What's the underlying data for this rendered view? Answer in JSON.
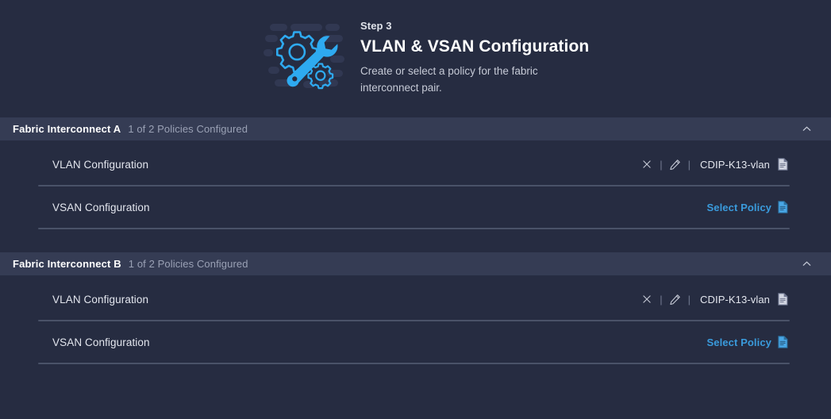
{
  "step": {
    "eyebrow": "Step 3",
    "title": "VLAN & VSAN Configuration",
    "description": "Create or select a policy for the fabric interconnect pair.",
    "icon": "gear-wrench-icon"
  },
  "colors": {
    "page_background": "#262c41",
    "section_header_background": "#353c54",
    "accent_blue": "#3a9bdc",
    "divider": "#4a5268",
    "text_primary": "#e6e8ef",
    "text_muted": "#9aa1b5"
  },
  "sections": [
    {
      "title": "Fabric Interconnect A",
      "subtitle": "1 of 2 Policies Configured",
      "collapse_icon": "chevron-up-icon",
      "expanded": true,
      "rows": [
        {
          "label": "VLAN Configuration",
          "state": "configured",
          "policy_name": "CDIP-K13-vlan",
          "delete_icon": "close-icon",
          "edit_icon": "pencil-icon",
          "policy_icon": "document-icon",
          "separator": "|"
        },
        {
          "label": "VSAN Configuration",
          "state": "unconfigured",
          "select_label": "Select Policy",
          "policy_icon": "document-icon"
        }
      ]
    },
    {
      "title": "Fabric Interconnect B",
      "subtitle": "1 of 2 Policies Configured",
      "collapse_icon": "chevron-up-icon",
      "expanded": true,
      "rows": [
        {
          "label": "VLAN Configuration",
          "state": "configured",
          "policy_name": "CDIP-K13-vlan",
          "delete_icon": "close-icon",
          "edit_icon": "pencil-icon",
          "policy_icon": "document-icon",
          "separator": "|"
        },
        {
          "label": "VSAN Configuration",
          "state": "unconfigured",
          "select_label": "Select Policy",
          "policy_icon": "document-icon"
        }
      ]
    }
  ]
}
